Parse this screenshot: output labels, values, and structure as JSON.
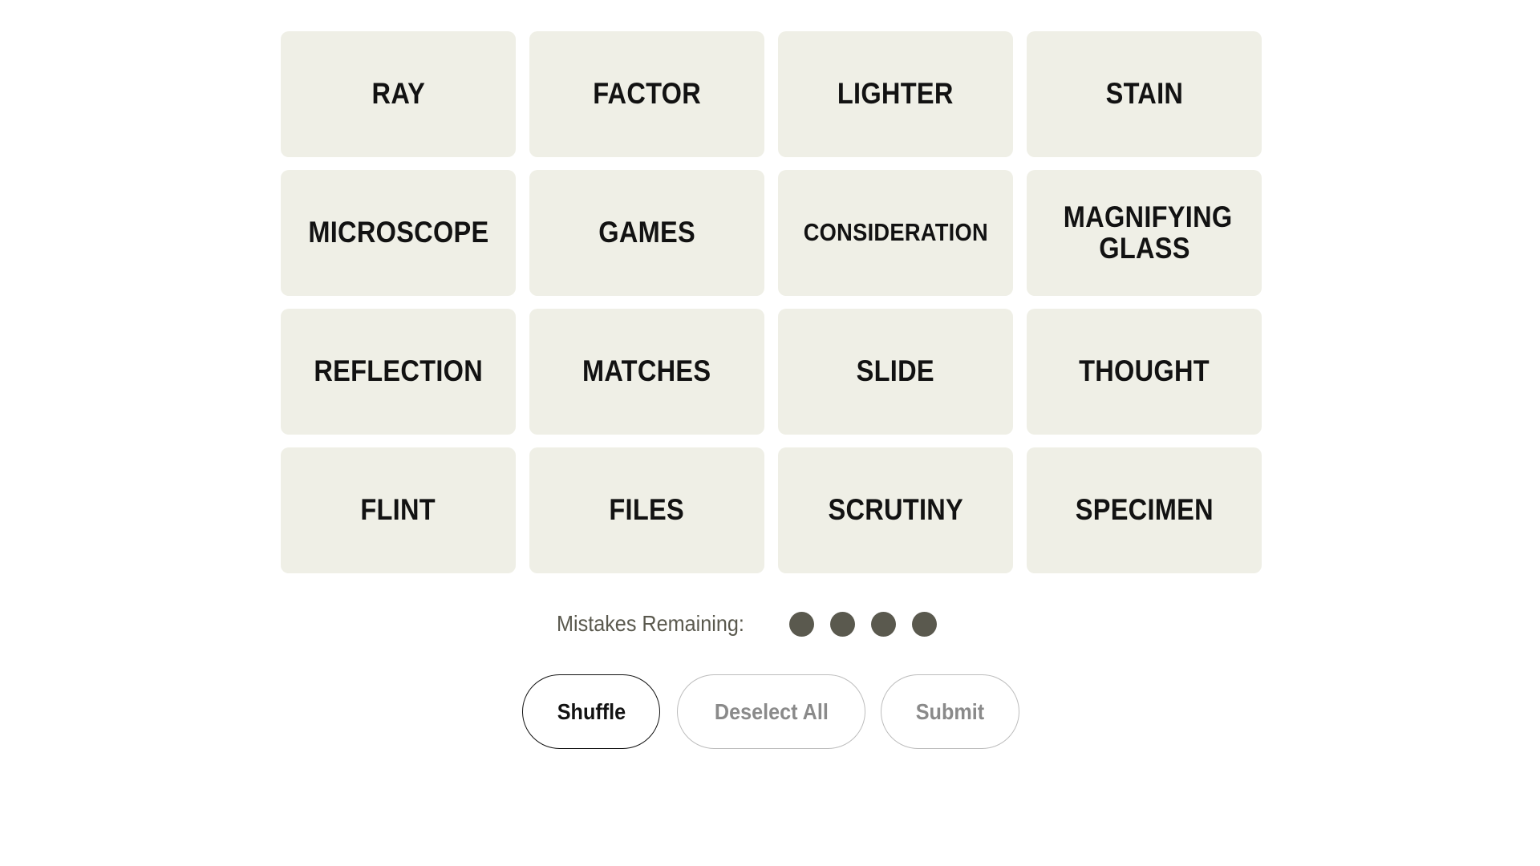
{
  "tiles": [
    "RAY",
    "FACTOR",
    "LIGHTER",
    "STAIN",
    "MICROSCOPE",
    "GAMES",
    "CONSIDERATION",
    "MAGNIFYING GLASS",
    "REFLECTION",
    "MATCHES",
    "SLIDE",
    "THOUGHT",
    "FLINT",
    "FILES",
    "SCRUTINY",
    "SPECIMEN"
  ],
  "mistakes": {
    "label": "Mistakes Remaining:",
    "remaining": 4,
    "dot_color": "#5a594e"
  },
  "buttons": {
    "shuffle": "Shuffle",
    "deselect_all": "Deselect All",
    "submit": "Submit"
  },
  "colors": {
    "tile_bg": "#efefe6",
    "text": "#121212"
  }
}
